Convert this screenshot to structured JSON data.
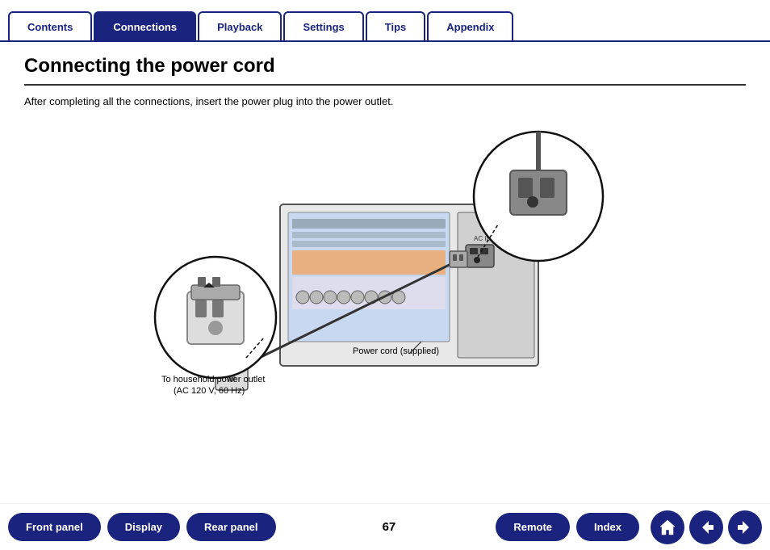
{
  "nav": {
    "tabs": [
      {
        "label": "Contents",
        "active": false
      },
      {
        "label": "Connections",
        "active": true
      },
      {
        "label": "Playback",
        "active": false
      },
      {
        "label": "Settings",
        "active": false
      },
      {
        "label": "Tips",
        "active": false
      },
      {
        "label": "Appendix",
        "active": false
      }
    ]
  },
  "page": {
    "title": "Connecting the power cord",
    "description": "After completing all the connections, insert the power plug into the power outlet.",
    "page_number": "67"
  },
  "diagram": {
    "outlet_label": "To household power outlet",
    "outlet_label2": "(AC 120 V, 60 Hz)",
    "power_cord_label": "Power cord (supplied)"
  },
  "bottom_nav": {
    "front_panel": "Front panel",
    "display": "Display",
    "rear_panel": "Rear panel",
    "remote": "Remote",
    "index": "Index"
  }
}
